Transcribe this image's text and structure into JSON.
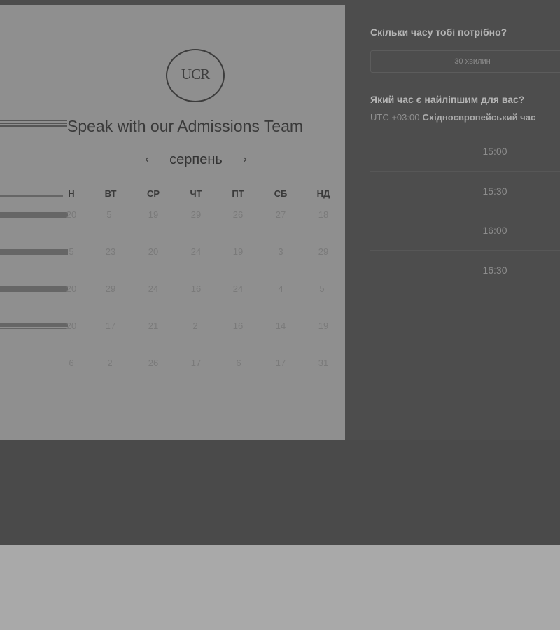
{
  "left": {
    "logo_text": "UCR",
    "title": "Speak with our Admissions Team",
    "month": "серпень",
    "prev_icon": "chevron-left-icon",
    "next_icon": "chevron-right-icon",
    "weekdays": [
      "Н",
      "ВТ",
      "СР",
      "ЧТ",
      "ПТ",
      "СБ",
      "НД"
    ],
    "rows": [
      [
        "20",
        "5",
        "19",
        "29",
        "26",
        "27",
        "18"
      ],
      [
        "5",
        "23",
        "20",
        "24",
        "19",
        "3",
        "29"
      ],
      [
        "20",
        "29",
        "24",
        "16",
        "24",
        "4",
        "5"
      ],
      [
        "20",
        "17",
        "21",
        "2",
        "16",
        "14",
        "19"
      ],
      [
        "6",
        "2",
        "26",
        "17",
        "6",
        "17",
        "31"
      ]
    ]
  },
  "right": {
    "duration_question": "Скільки часу тобі потрібно?",
    "duration_value": "30 хвилин",
    "time_question": "Який час є найліпшим для вас?",
    "tz_offset": "UTC +03:00",
    "tz_name": "Східноєвропейський час",
    "slots": [
      "15:00",
      "15:30",
      "16:00",
      "16:30"
    ]
  }
}
